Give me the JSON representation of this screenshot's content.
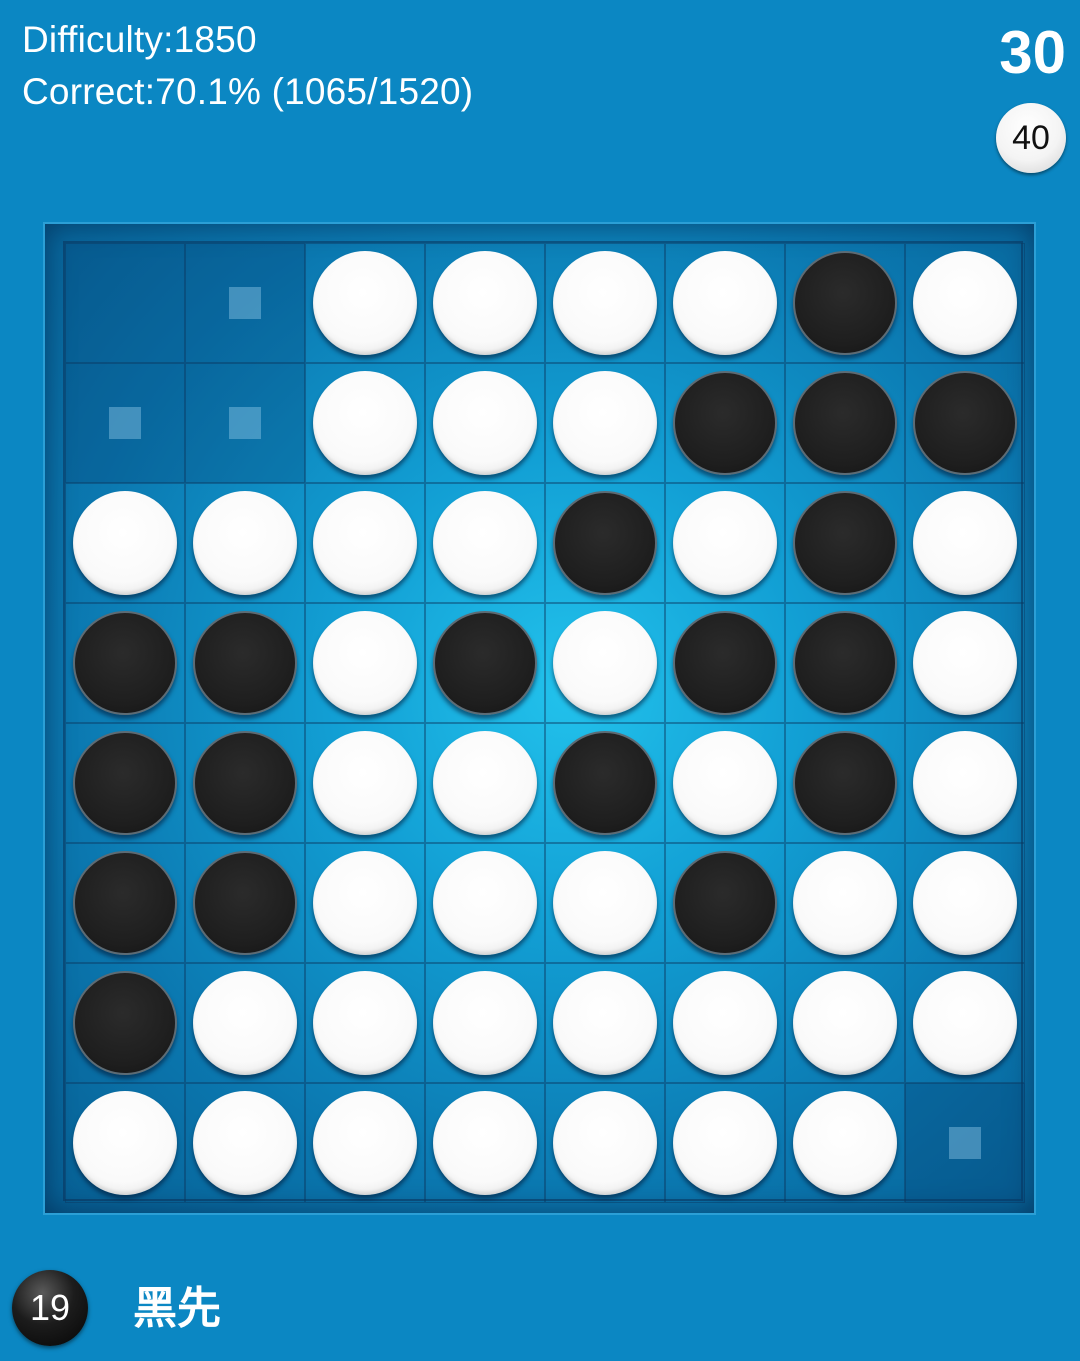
{
  "header": {
    "difficulty_label": "Difficulty:1850",
    "correct_label": "Correct:70.1% (1065/1520)",
    "move_count": "30",
    "white_count": "40"
  },
  "colors": {
    "background": "#0b87c3",
    "board": "#129fd4",
    "black_disc": "#1e1e1e",
    "white_disc": "#fafafa"
  },
  "board": {
    "size": 8,
    "legend": {
      "B": "black disc",
      "W": "white disc",
      "h": "legal move hint",
      ".": "empty"
    },
    "rows": [
      ". h W W W W B W",
      "h h W W W B B B",
      "W W W W B W B W",
      "B B W B W B B W",
      "B B W W B W B W",
      "B B W W W B W W",
      "B W W W W W W W",
      "W W W W W W W h"
    ]
  },
  "footer": {
    "black_count": "19",
    "turn_label": "黑先"
  }
}
